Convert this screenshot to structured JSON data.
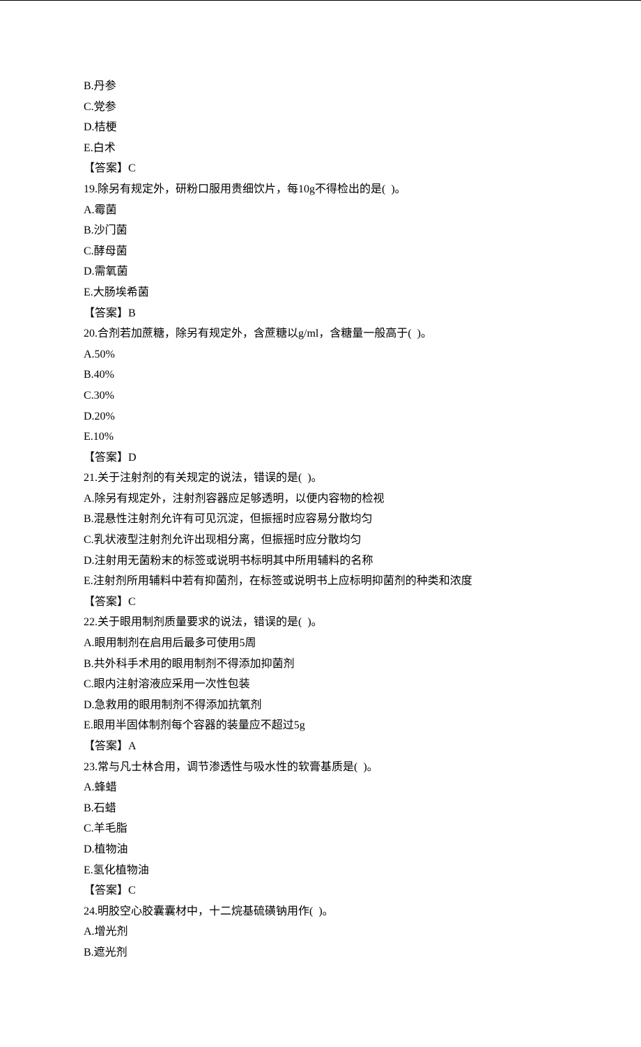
{
  "lines": [
    "B.丹参",
    "C.党参",
    "D.桔梗",
    "E.白术",
    "【答案】C",
    "19.除另有规定外，研粉口服用贵细饮片，每10g不得检出的是(  )。",
    "A.霉菌",
    "B.沙门菌",
    "C.酵母菌",
    "D.需氧菌",
    "E.大肠埃希菌",
    "【答案】B",
    "20.合剂若加蔗糖，除另有规定外，含蔗糖以g/ml，含糖量一般高于(  )。",
    "A.50%",
    "B.40%",
    "C.30%",
    "D.20%",
    "E.10%",
    "【答案】D",
    "21.关于注射剂的有关规定的说法，错误的是(  )。",
    "A.除另有规定外，注射剂容器应足够透明，以便内容物的检视",
    "B.混悬性注射剂允许有可见沉淀，但振摇时应容易分散均匀",
    "C.乳状液型注射剂允许出现相分离，但振摇时应分散均匀",
    "D.注射用无菌粉末的标签或说明书标明其中所用辅料的名称",
    "E.注射剂所用辅料中若有抑菌剂，在标签或说明书上应标明抑菌剂的种类和浓度",
    "【答案】C",
    "22.关于眼用制剂质量要求的说法，错误的是(  )。",
    "A.眼用制剂在启用后最多可使用5周",
    "B.共外科手术用的眼用制剂不得添加抑菌剂",
    "C.眼内注射溶液应采用一次性包装",
    "D.急救用的眼用制剂不得添加抗氧剂",
    "E.眼用半固体制剂每个容器的装量应不超过5g",
    "【答案】A",
    "23.常与凡士林合用，调节渗透性与吸水性的软膏基质是(  )。",
    "A.蜂蜡",
    "B.石蜡",
    "C.羊毛脂",
    "D.植物油",
    "E.氢化植物油",
    "【答案】C",
    "24.明胶空心胶囊囊材中，十二烷基硫磺钠用作(  )。",
    "A.增光剂",
    "B.遮光剂"
  ]
}
